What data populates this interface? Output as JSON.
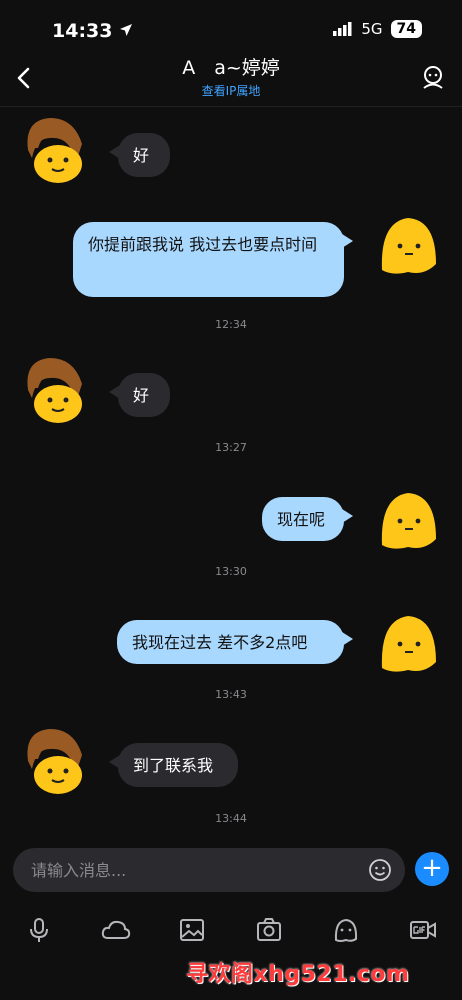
{
  "status_bar": {
    "time": "14:33",
    "network": "5G",
    "battery": "74"
  },
  "header": {
    "title": "A　a~婷婷",
    "subtitle": "查看IP属地"
  },
  "messages": [
    {
      "side": "left",
      "text": "好"
    },
    {
      "side": "right",
      "text": "你提前跟我说 我过去也要点时间"
    },
    {
      "side": "left",
      "text": "好"
    },
    {
      "side": "right",
      "text": "现在呢"
    },
    {
      "side": "right",
      "text": "我现在过去 差不多2点吧"
    },
    {
      "side": "left",
      "text": "到了联系我"
    }
  ],
  "timestamps": [
    "12:34",
    "13:27",
    "13:30",
    "13:43",
    "13:44"
  ],
  "input": {
    "placeholder": "请输入消息..."
  },
  "toolbar": [
    "microphone-icon",
    "cloud-icon",
    "image-icon",
    "camera-icon",
    "sticker-icon",
    "gif-icon"
  ],
  "watermark": "寻欢阁xhg521.com",
  "colors": {
    "accent": "#1b8cff",
    "incoming_bubble": "#2b2b2f",
    "outgoing_bubble": "#a9d8ff",
    "background": "#0f0f10"
  }
}
